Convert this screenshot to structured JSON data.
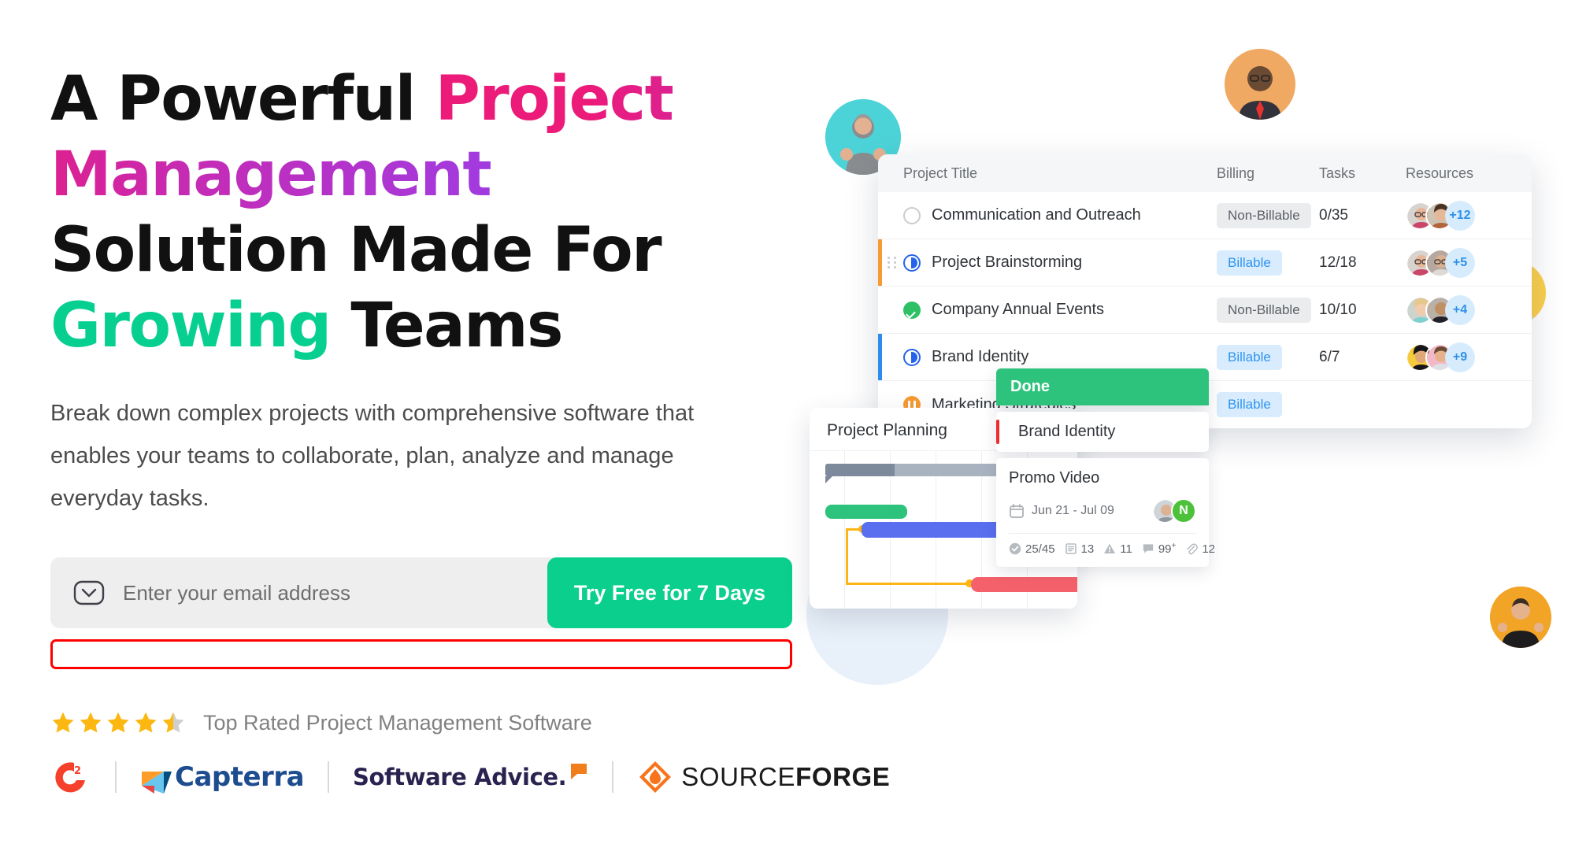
{
  "hero": {
    "headline_parts": [
      {
        "text": "A Powerful ",
        "style": "plain"
      },
      {
        "text": "Project Management",
        "style": "gradient"
      },
      {
        "text": " Solution Made For ",
        "style": "plain"
      },
      {
        "text": "Growing",
        "style": "green"
      },
      {
        "text": " Teams",
        "style": "plain"
      }
    ],
    "headline_plain_1": "A Powerful ",
    "headline_gradient": "Project Management",
    "headline_plain_2": " Solution Made For ",
    "headline_green": "Growing",
    "headline_plain_3": " Teams",
    "subcopy": "Break down complex projects with comprehensive software that enables your teams to collaborate, plan, analyze and manage everyday tasks."
  },
  "signup": {
    "mail_icon": "mail-chevron-icon",
    "email_value": "",
    "email_placeholder": "Enter your email address",
    "cta_label": "Try Free for 7 Days",
    "error_text": ""
  },
  "rating": {
    "value": 4.5,
    "max": 5,
    "filled": 4,
    "half": 1,
    "label": "Top Rated Project Management Software",
    "star_color": "#fcb711",
    "star_empty_color": "#cfcfcf"
  },
  "logos": [
    {
      "name": "g2-logo",
      "text": "G2"
    },
    {
      "name": "capterra-logo",
      "text": "Capterra"
    },
    {
      "name": "software-advice-logo",
      "text": "Software Advice."
    },
    {
      "name": "sourceforge-logo",
      "text_light": "SOURCE",
      "text_bold": "FORGE"
    }
  ],
  "colors": {
    "accent_green": "#0bcf8d",
    "pink": "#ec1a78",
    "purple": "#a13be0",
    "teal": "#07cf8f",
    "error_red": "#fe0000"
  },
  "table": {
    "headers": [
      "Project Title",
      "Billing",
      "Tasks",
      "Resources"
    ],
    "rows": [
      {
        "status": "empty",
        "accent": "",
        "drag": false,
        "title": "Communication and Outreach",
        "billing": "Non-Billable",
        "billing_type": "non",
        "tasks": "0/35",
        "more": "+12"
      },
      {
        "status": "blue",
        "accent": "#f79a32",
        "drag": true,
        "title": "Project Brainstorming",
        "billing": "Billable",
        "billing_type": "bill",
        "tasks": "12/18",
        "more": "+5"
      },
      {
        "status": "green",
        "accent": "",
        "drag": false,
        "title": "Company Annual Events",
        "billing": "Non-Billable",
        "billing_type": "non",
        "tasks": "10/10",
        "more": "+4"
      },
      {
        "status": "blue",
        "accent": "#2d8cf0",
        "drag": false,
        "title": "Brand Identity",
        "billing": "Billable",
        "billing_type": "bill",
        "tasks": "6/7",
        "more": "+9"
      },
      {
        "status": "orange",
        "accent": "",
        "drag": false,
        "title": "Marketing Strategies",
        "billing": "Billable",
        "billing_type": "bill",
        "tasks": "",
        "more": ""
      }
    ]
  },
  "gantt": {
    "title": "Project Planning",
    "bars": [
      {
        "name": "summary-bar",
        "color": "#7d8a9c"
      },
      {
        "name": "task-green",
        "color": "#2ec37d"
      },
      {
        "name": "task-blue",
        "color": "#5a6ff0"
      },
      {
        "name": "task-red",
        "color": "#f4616b"
      }
    ],
    "dependency_color": "#fdb515"
  },
  "kanban": {
    "column_title": "Done",
    "column_color": "#2ec37d",
    "cards": [
      {
        "title": "Brand Identity",
        "bar_color": "#f02b2b",
        "date": "",
        "stats": []
      },
      {
        "title": "Promo Video",
        "bar_color": "",
        "date": "Jun 21 - Jul 09",
        "avatar_initial": "N",
        "stats": [
          {
            "icon": "check-circle-icon",
            "value": "25/45"
          },
          {
            "icon": "list-icon",
            "value": "13"
          },
          {
            "icon": "warning-icon",
            "value": "11"
          },
          {
            "icon": "comment-icon",
            "value": "99",
            "sup": "+"
          },
          {
            "icon": "attachment-icon",
            "value": "12"
          }
        ]
      }
    ]
  },
  "floating_avatars": [
    {
      "name": "avatar-thumbs-up-man",
      "bg": "#4cd3d8"
    },
    {
      "name": "avatar-suit-man",
      "bg": "#f0a962"
    },
    {
      "name": "avatar-white-dress-woman",
      "bg": "#f6c2cf"
    },
    {
      "name": "avatar-grey-shirt-man",
      "bg": "#fbcf4e"
    },
    {
      "name": "avatar-black-tee-man",
      "bg": "#f2a427"
    }
  ]
}
